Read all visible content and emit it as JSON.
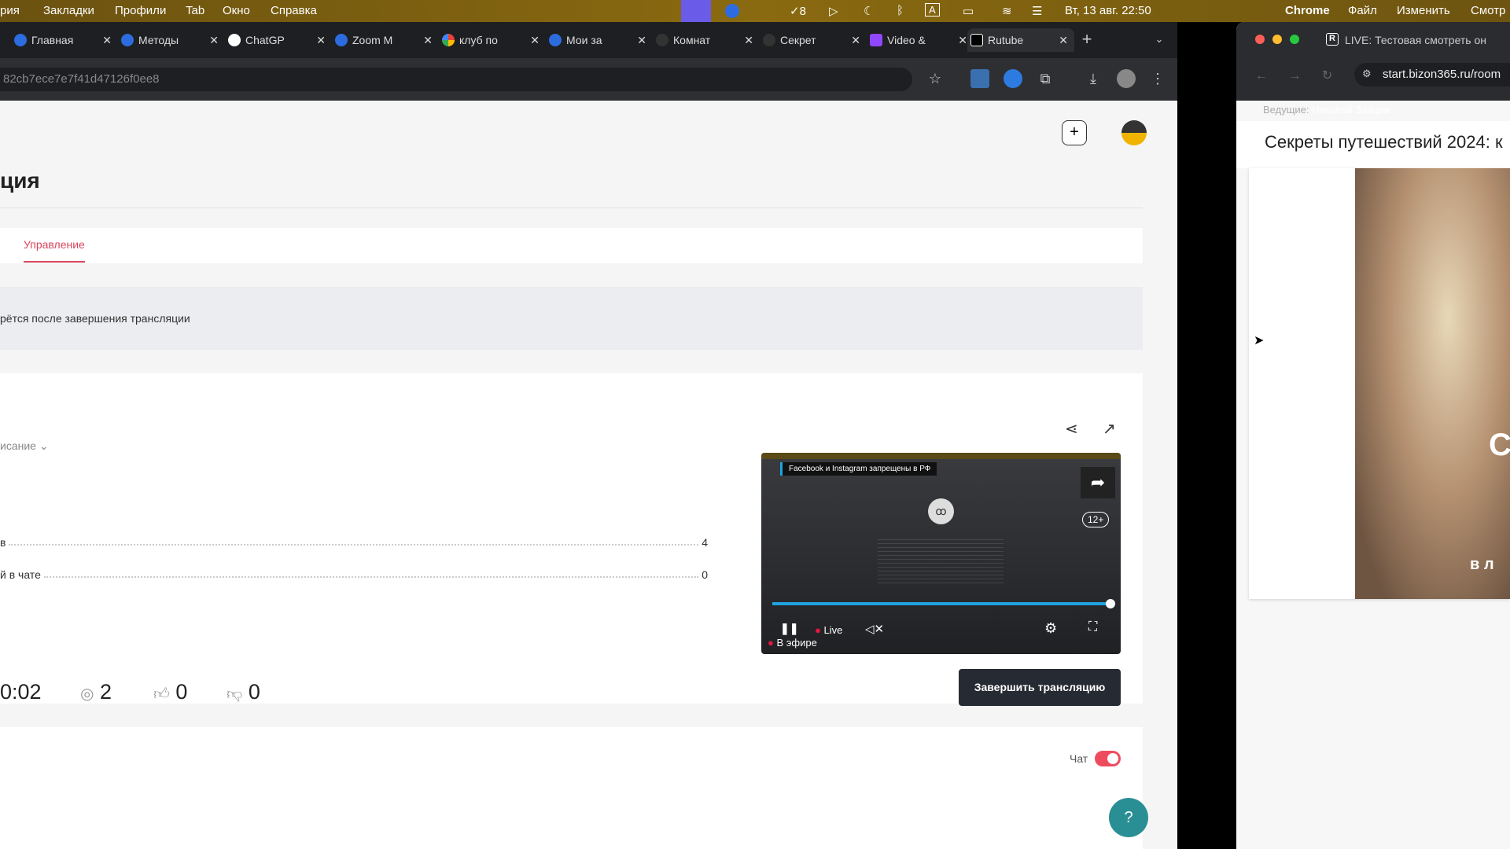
{
  "menubar": {
    "left_items": [
      "рия",
      "Закладки",
      "Профили",
      "Tab",
      "Окно",
      "Справка"
    ],
    "checks_count": "8",
    "datetime": "Вт, 13 авг. 22:50",
    "right_items": [
      "Chrome",
      "Файл",
      "Изменить",
      "Смотр"
    ]
  },
  "browser_left": {
    "tabs": [
      "Главная",
      "Методы",
      "ChatGP",
      "Zoom M",
      "клуб по",
      "Мои за",
      "Комнат",
      "Секрет",
      "Video &",
      "Rutube"
    ],
    "url": "82cb7ece7e7f41d47126f0ee8"
  },
  "page": {
    "title": "ция",
    "tab_active": "Управление",
    "info_text": "рётся после завершения трансляции",
    "description_toggle": "исание",
    "stats": [
      {
        "label": "в",
        "value": "4"
      },
      {
        "label": "й в чате",
        "value": "0"
      }
    ],
    "duration": "0:02",
    "viewers": "2",
    "likes": "0",
    "dislikes": "0",
    "end_button": "Завершить трансляцию",
    "chat_label": "Чат",
    "chat_enabled": true,
    "accent": "#d9475f"
  },
  "player": {
    "banner": "Facebook и Instagram запрещены в РФ",
    "age": "12+",
    "live": "Live",
    "on_air": "В эфире",
    "progress": 1.0
  },
  "browser_right": {
    "tab_title": "LIVE: Тестовая смотреть он",
    "url": "start.bizon365.ru/room",
    "host_label": "Ведущие:",
    "host_name": "Николай Зайцев",
    "event_title": "Секреты путешествий 2024: к",
    "overlay_text": "С",
    "overlay_sub": "в л"
  }
}
